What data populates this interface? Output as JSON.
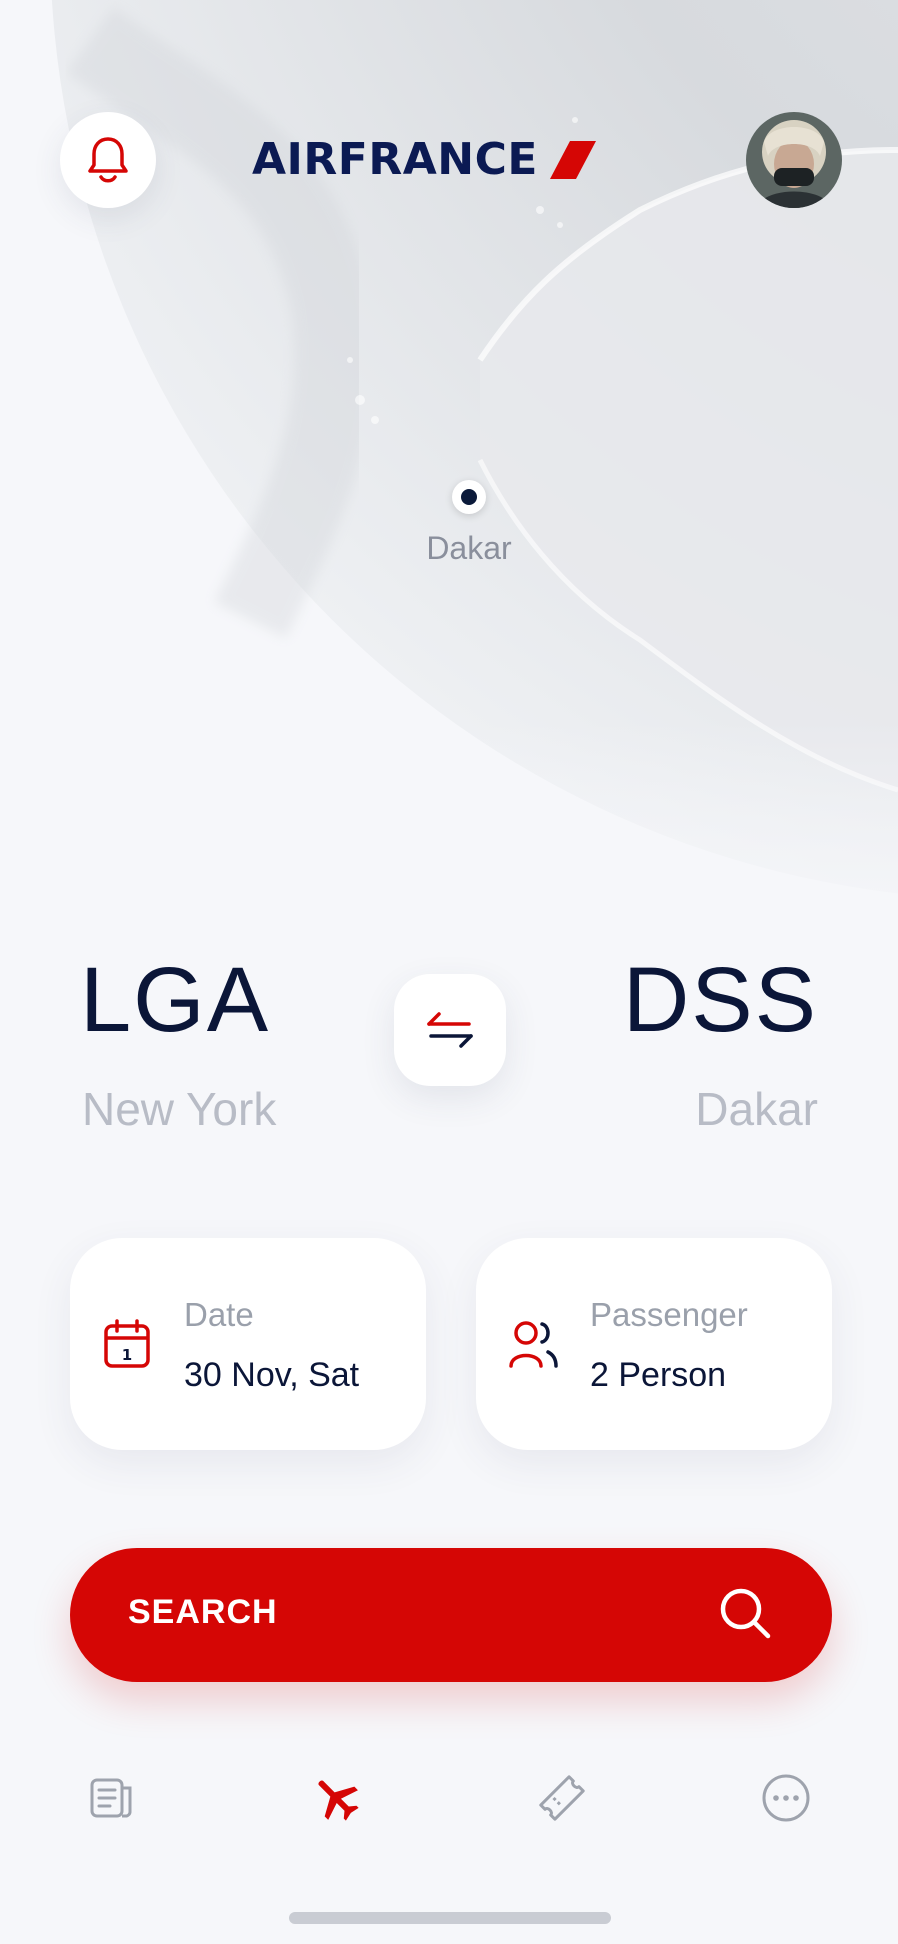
{
  "header": {
    "logo_text": "AIRFRANCE",
    "notification_icon": "bell-icon",
    "avatar_icon": "user-avatar"
  },
  "map": {
    "pin_label": "Dakar"
  },
  "route": {
    "from_code": "LGA",
    "from_city": "New York",
    "to_code": "DSS",
    "to_city": "Dakar",
    "swap_icon": "swap-arrows-icon"
  },
  "date_card": {
    "label": "Date",
    "value": "30 Nov, Sat",
    "icon": "calendar-icon",
    "icon_day": "1"
  },
  "passenger_card": {
    "label": "Passenger",
    "value": "2 Person",
    "icon": "users-icon"
  },
  "search": {
    "label": "SEARCH",
    "icon": "search-icon"
  },
  "bottom_nav": {
    "items": [
      "news-icon",
      "flight-icon",
      "ticket-icon",
      "more-icon"
    ],
    "active_index": 1
  },
  "colors": {
    "brand_red": "#d50605",
    "navy": "#0b1638",
    "background": "#f6f7fa"
  }
}
